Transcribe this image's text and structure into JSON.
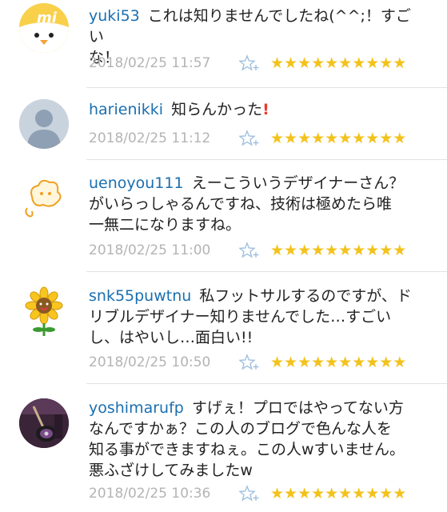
{
  "comments": [
    {
      "username": "yuki53",
      "text": "これは知りませんでしたね(^^;！すごいな！",
      "line1": "これは知りませんでしたね(^^;！すごい",
      "line2": "な！",
      "timestamp": "2018/02/25 11:57",
      "stars": "★★★★★★★★★★",
      "avatar_icon": "mi-chick-avatar-icon"
    },
    {
      "username": "harienikki",
      "text": "知らんかった",
      "exclaim": "!",
      "timestamp": "2018/02/25 11:12",
      "stars": "★★★★★★★★★★",
      "avatar_icon": "default-user-avatar-icon"
    },
    {
      "username": "uenoyou111",
      "line1": "えーこういうデザイナーさん？",
      "line2": "がいらっしゃるんですね、技術は極めたら唯",
      "line3": "一無二になりますね。",
      "timestamp": "2018/02/25 11:00",
      "stars": "★★★★★★★★★★",
      "avatar_icon": "cloud-character-avatar-icon"
    },
    {
      "username": "snk55puwtnu",
      "line1": "私フットサルするのですが、ド",
      "line2": "リブルデザイナー知りませんでした…すごい",
      "line3": "し、はやいし…面白い!!",
      "timestamp": "2018/02/25 10:50",
      "stars": "★★★★★★★★★★",
      "avatar_icon": "sunflower-avatar-icon"
    },
    {
      "username": "yoshimarufp",
      "line1": "すげぇ！プロではやってない方",
      "line2": "なんですかぁ？この人のブログで色んな人を",
      "line3": "知る事ができますねぇ。この人wすいません。",
      "line4": "悪ふざけしてみましたw",
      "timestamp": "2018/02/25 10:36",
      "stars": "★★★★★★★★★★",
      "avatar_icon": "guitar-photo-avatar-icon"
    }
  ],
  "colors": {
    "username": "#1a6fb0",
    "timestamp": "#b4b4b4",
    "star": "#f3c21b",
    "exclaim": "#e53b2c",
    "star_add": "#9fc0e0"
  }
}
